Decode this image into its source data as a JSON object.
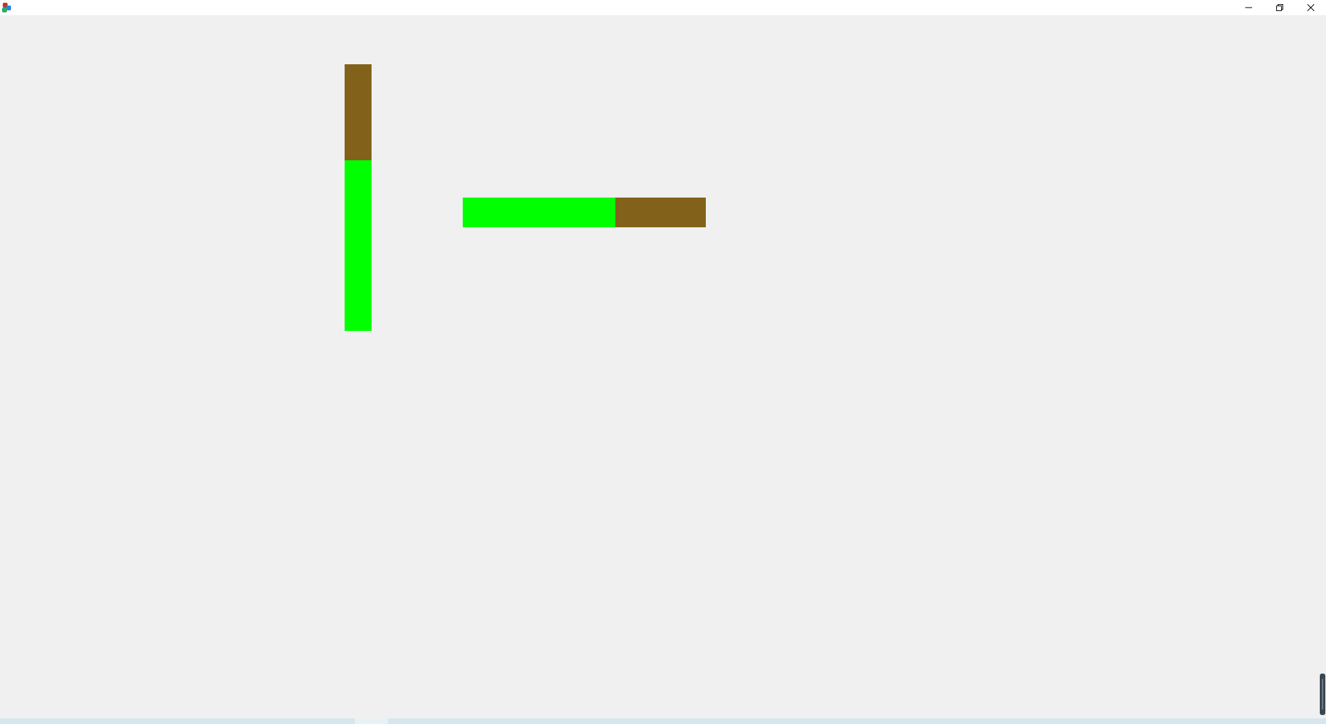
{
  "window": {
    "controls": {
      "minimize": "minimize-icon",
      "restore": "restore-icon",
      "close": "close-icon"
    }
  },
  "shapes": {
    "vertical_bar": {
      "colors": {
        "top": "#82621a",
        "bottom": "#00ff00"
      }
    },
    "horizontal_bar": {
      "colors": {
        "left": "#00ff00",
        "right": "#82621a"
      }
    }
  },
  "colors": {
    "background": "#f0f0f0",
    "titlebar": "#ffffff",
    "brown": "#82621a",
    "green": "#00ff00"
  }
}
